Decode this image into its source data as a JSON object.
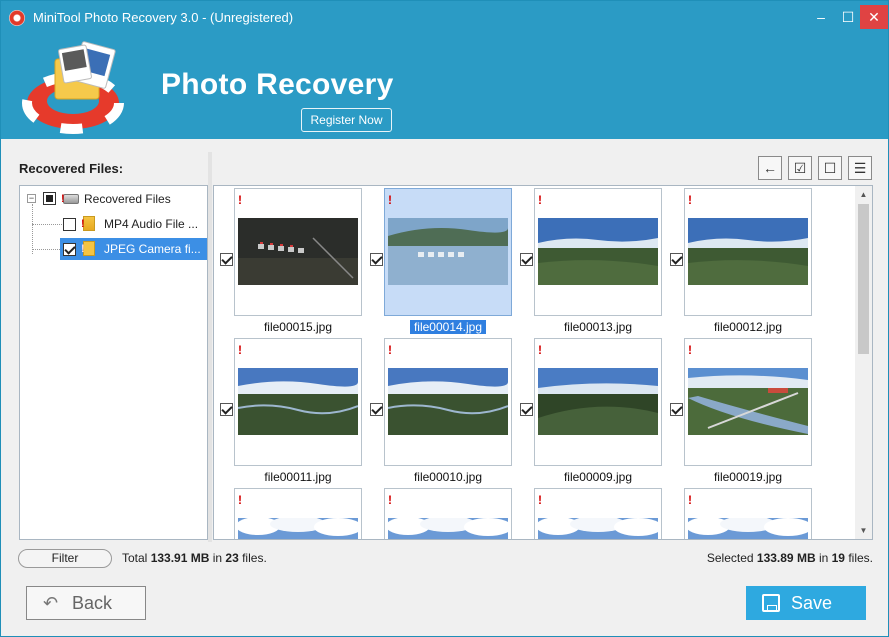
{
  "window": {
    "title": "MiniTool Photo Recovery 3.0 - (Unregistered)",
    "controls": {
      "minimize": "–",
      "maximize": "☐",
      "close": "✕"
    }
  },
  "header": {
    "heading": "Photo Recovery",
    "register_label": "Register Now",
    "accent": "#2b9bc5"
  },
  "tree": {
    "label": "Recovered Files:",
    "root": {
      "label": "Recovered Files",
      "state": "partial",
      "expander": "−"
    },
    "items": [
      {
        "label": "MP4 Audio File ...",
        "checked": false,
        "selected": false
      },
      {
        "label": "JPEG Camera fi...",
        "checked": true,
        "selected": true
      }
    ]
  },
  "toolbar": {
    "back_icon": "←",
    "check_all_icon": "☑",
    "uncheck_all_icon": "☐",
    "list_view_icon": "☰"
  },
  "thumbnails": [
    {
      "name": "file00015.jpg",
      "checked": true,
      "selected": false,
      "scene": "night"
    },
    {
      "name": "file00014.jpg",
      "checked": true,
      "selected": true,
      "scene": "lake"
    },
    {
      "name": "file00013.jpg",
      "checked": true,
      "selected": false,
      "scene": "sky"
    },
    {
      "name": "file00012.jpg",
      "checked": true,
      "selected": false,
      "scene": "sky"
    },
    {
      "name": "file00011.jpg",
      "checked": true,
      "selected": false,
      "scene": "river"
    },
    {
      "name": "file00010.jpg",
      "checked": true,
      "selected": false,
      "scene": "river"
    },
    {
      "name": "file00009.jpg",
      "checked": true,
      "selected": false,
      "scene": "hills"
    },
    {
      "name": "file00019.jpg",
      "checked": true,
      "selected": false,
      "scene": "bridge"
    },
    {
      "name": "",
      "checked": false,
      "selected": false,
      "scene": "clouds"
    },
    {
      "name": "",
      "checked": false,
      "selected": false,
      "scene": "clouds"
    },
    {
      "name": "",
      "checked": false,
      "selected": false,
      "scene": "clouds"
    },
    {
      "name": "",
      "checked": false,
      "selected": false,
      "scene": "clouds"
    }
  ],
  "footer": {
    "filter_label": "Filter",
    "total_prefix": "Total ",
    "total_size": "133.91 MB",
    "total_mid": " in ",
    "total_count": "23",
    "total_suffix": " files.",
    "selected_prefix": "Selected ",
    "selected_size": "133.89 MB",
    "selected_mid": " in ",
    "selected_count": "19",
    "selected_suffix": " files.",
    "back_label": "Back",
    "save_label": "Save"
  },
  "scrollbar": {
    "up": "▲",
    "down": "▼"
  }
}
